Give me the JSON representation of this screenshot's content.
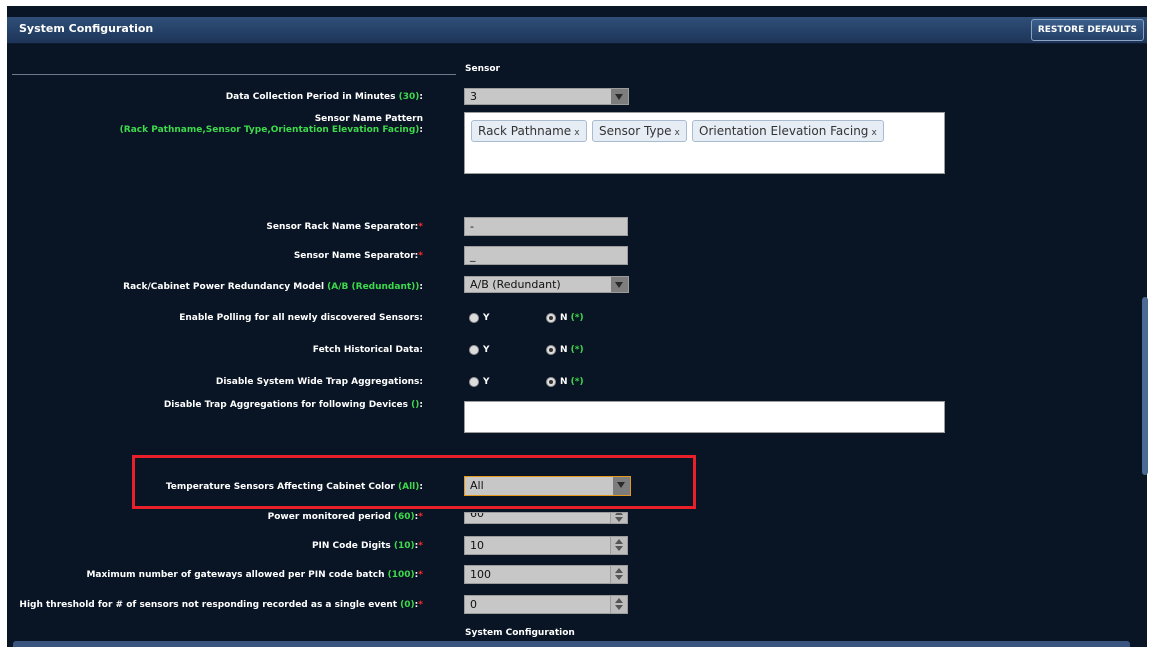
{
  "header": {
    "title": "System Configuration",
    "restore_label": "RESTORE DEFAULTS"
  },
  "section_sensor": "Sensor",
  "section_system": "System Configuration",
  "fields": {
    "data_collection": {
      "label": "Data Collection Period in Minutes ",
      "default": "(30)",
      "colon": ":",
      "value": "3"
    },
    "name_pattern": {
      "label": "Sensor Name Pattern",
      "default": "(Rack Pathname,Sensor Type,Orientation Elevation Facing)",
      "colon": ":",
      "tags": [
        "Rack Pathname",
        "Sensor Type",
        "Orientation Elevation Facing"
      ],
      "tag_remove": "x"
    },
    "rack_sep": {
      "label": "Sensor Rack Name Separator:",
      "req": "*",
      "value": "-"
    },
    "name_sep": {
      "label": "Sensor Name Separator:",
      "req": "*",
      "value": "_"
    },
    "redundancy": {
      "label": "Rack/Cabinet Power Redundancy Model ",
      "default": "(A/B (Redundant))",
      "colon": ":",
      "value": "A/B (Redundant)"
    },
    "enable_polling": {
      "label": "Enable Polling for all newly discovered Sensors:",
      "yes": "Y",
      "no": "N ",
      "no_default": "(*)",
      "selected": "N"
    },
    "fetch_historical": {
      "label": "Fetch Historical Data:",
      "yes": "Y",
      "no": "N ",
      "no_default": "(*)",
      "selected": "N"
    },
    "disable_trap": {
      "label": "Disable System Wide Trap Aggregations:",
      "yes": "Y",
      "no": "N ",
      "no_default": "(*)",
      "selected": "N"
    },
    "trap_devices": {
      "label": "Disable Trap Aggregations for following Devices ",
      "default": "()",
      "colon": ":",
      "value": ""
    },
    "temp_sensors": {
      "label": "Temperature Sensors Affecting Cabinet Color ",
      "default": "(All)",
      "colon": ":",
      "value": "All"
    },
    "power_period": {
      "label": "Power monitored period ",
      "default": "(60)",
      "colon": ":",
      "req": "*",
      "value": "60"
    },
    "pin_digits": {
      "label": "PIN Code Digits ",
      "default": "(10)",
      "colon": ":",
      "req": "*",
      "value": "10"
    },
    "max_gateways": {
      "label": "Maximum number of gateways allowed per PIN code batch ",
      "default": "(100)",
      "colon": ":",
      "req": "*",
      "value": "100"
    },
    "high_threshold": {
      "label": "High threshold for # of sensors not responding recorded as a single event ",
      "default": "(0)",
      "colon": ":",
      "req": "*",
      "value": "0"
    }
  }
}
